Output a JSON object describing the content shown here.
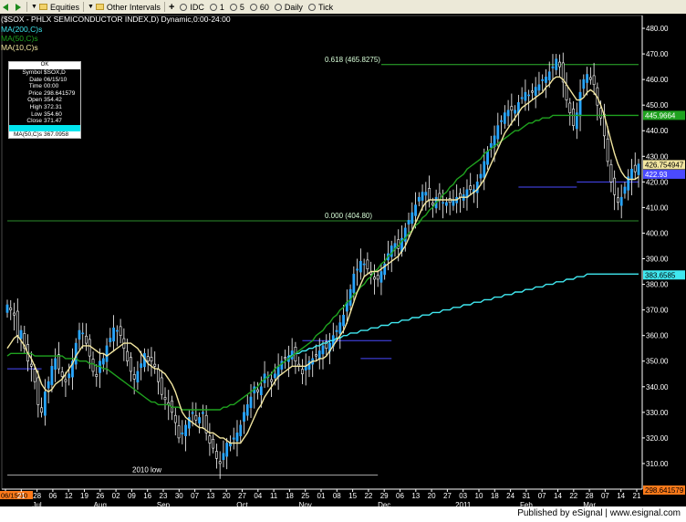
{
  "toolbar": {
    "equities_label": "Equities",
    "other_intervals_label": "Other Intervals",
    "intervals": [
      "IDC",
      "1",
      "5",
      "60",
      "Daily",
      "Tick"
    ]
  },
  "chart_header": {
    "title": "($SOX - PHLX SEMICONDUCTOR INDEX,D) Dynamic,0:00-24:00",
    "ma200_label": "MA(200,C)s",
    "ma50_label": "MA(50,C)s",
    "ma10_label": "MA(10,C)s"
  },
  "data_window": {
    "header": "OK",
    "rows": [
      {
        "k": "Symbol",
        "v": "$SOX,D"
      },
      {
        "k": "Date",
        "v": "06/15/10"
      },
      {
        "k": "Time",
        "v": "00:00"
      },
      {
        "k": "Price",
        "v": "298.641579"
      },
      {
        "k": "Open",
        "v": "354.42"
      },
      {
        "k": "High",
        "v": "372.31"
      },
      {
        "k": "Low",
        "v": "354.60"
      },
      {
        "k": "Close",
        "v": "371.47"
      }
    ],
    "ma200_row": {
      "k": "MA(200,C)s",
      "v": ""
    },
    "ma50_row": {
      "k": "MA(50,C)s",
      "v": "367.0958"
    }
  },
  "footer": {
    "text": "Published by eSignal | www.esignal.com"
  },
  "colors": {
    "candle": "#28a6ff",
    "ma10": "#f2e6a0",
    "ma50": "#1fa21f",
    "ma200": "#40e8f0",
    "fib": "#2fb52f",
    "resistance": "#4a4aff",
    "axis": "#ffffff"
  },
  "chart_data": {
    "type": "candlestick",
    "ylim": [
      300,
      485
    ],
    "yticks": [
      310,
      320,
      330,
      340,
      350,
      360,
      370,
      380,
      390,
      400,
      410,
      420,
      430,
      440,
      450,
      460,
      470,
      480
    ],
    "x_tick_labels": [
      "06/15/10",
      "21",
      "28",
      "06",
      "12",
      "19",
      "26",
      "02",
      "09",
      "16",
      "23",
      "30",
      "07",
      "13",
      "20",
      "27",
      "04",
      "11",
      "18",
      "25",
      "01",
      "08",
      "15",
      "22",
      "29",
      "06",
      "13",
      "20",
      "27",
      "03",
      "10",
      "18",
      "24",
      "31",
      "07",
      "14",
      "22",
      "28",
      "07",
      "14",
      "21"
    ],
    "month_labels": [
      "Jul",
      "Aug",
      "Sep",
      "Oct",
      "Nov",
      "Dec",
      "2011",
      "Feb",
      "Mar"
    ],
    "closes": [
      372,
      370,
      368,
      360,
      362,
      355,
      350,
      348,
      342,
      333,
      330,
      338,
      342,
      348,
      351,
      347,
      344,
      342,
      345,
      350,
      357,
      362,
      361,
      357,
      352,
      346,
      344,
      350,
      351,
      356,
      359,
      363,
      362,
      360,
      355,
      350,
      346,
      343,
      346,
      349,
      353,
      350,
      350,
      348,
      342,
      337,
      335,
      333,
      330,
      326,
      320,
      322,
      325,
      328,
      330,
      327,
      328,
      330,
      322,
      318,
      316,
      312,
      310,
      314,
      318,
      318,
      320,
      322,
      325,
      330,
      333,
      336,
      340,
      338,
      340,
      345,
      344,
      342,
      345,
      348,
      350,
      351,
      352,
      354,
      350,
      348,
      345,
      348,
      350,
      351,
      352,
      354,
      356,
      355,
      357,
      360,
      362,
      365,
      368,
      373,
      378,
      384,
      386,
      389,
      388,
      386,
      384,
      382,
      382,
      385,
      388,
      392,
      395,
      396,
      394,
      398,
      402,
      405,
      408,
      411,
      414,
      416,
      416,
      413,
      411,
      414,
      413,
      412,
      412,
      412,
      413,
      414,
      414,
      415,
      417,
      417,
      417,
      420,
      423,
      428,
      432,
      435,
      438,
      442,
      444,
      447,
      448,
      448,
      448,
      451,
      453,
      455,
      454,
      455,
      457,
      458,
      460,
      461,
      463,
      465,
      468,
      465,
      459,
      452,
      447,
      442,
      447,
      455,
      460,
      462,
      460,
      458,
      450,
      445,
      438,
      428,
      420,
      415,
      412,
      414,
      418,
      422,
      425,
      424,
      427
    ],
    "ma10": [
      355,
      357,
      359,
      360,
      358,
      356,
      353,
      351,
      348,
      345,
      341,
      339,
      338,
      339,
      341,
      342,
      343,
      345,
      347,
      349,
      352,
      354,
      356,
      356,
      356,
      355,
      354,
      353,
      353,
      352,
      353,
      354,
      355,
      356,
      357,
      357,
      357,
      356,
      355,
      353,
      351,
      349,
      348,
      347,
      347,
      346,
      345,
      343,
      341,
      338,
      334,
      330,
      328,
      327,
      326,
      325,
      324,
      324,
      323,
      322,
      322,
      321,
      320,
      320,
      319,
      318,
      318,
      318,
      318,
      320,
      322,
      325,
      328,
      331,
      333,
      336,
      338,
      340,
      342,
      344,
      345,
      346,
      347,
      348,
      348,
      348,
      348,
      348,
      349,
      350,
      350,
      351,
      351,
      352,
      354,
      356,
      358,
      360,
      362,
      365,
      369,
      373,
      377,
      380,
      383,
      384,
      385,
      385,
      385,
      386,
      387,
      388,
      389,
      390,
      391,
      393,
      395,
      398,
      401,
      404,
      407,
      410,
      412,
      413,
      413,
      413,
      413,
      413,
      413,
      413,
      413,
      413,
      414,
      414,
      414,
      415,
      416,
      417,
      419,
      421,
      424,
      427,
      430,
      433,
      436,
      439,
      441,
      443,
      445,
      447,
      449,
      450,
      451,
      452,
      453,
      454,
      455,
      457,
      458,
      460,
      461,
      461,
      460,
      458,
      456,
      454,
      452,
      452,
      453,
      455,
      456,
      455,
      453,
      450,
      446,
      441,
      436,
      431,
      427,
      424,
      422,
      421,
      421,
      421,
      422
    ],
    "ma50": [
      352,
      353,
      353,
      353,
      353,
      353,
      353,
      353,
      352,
      352,
      352,
      352,
      352,
      352,
      352,
      352,
      352,
      351,
      351,
      351,
      351,
      350,
      350,
      350,
      349,
      349,
      348,
      348,
      347,
      347,
      346,
      345,
      344,
      343,
      342,
      341,
      340,
      339,
      338,
      337,
      336,
      335,
      334,
      334,
      333,
      333,
      333,
      333,
      332,
      332,
      332,
      331,
      331,
      331,
      331,
      331,
      331,
      331,
      331,
      331,
      331,
      331,
      331,
      332,
      332,
      333,
      333,
      334,
      335,
      336,
      337,
      338,
      339,
      340,
      342,
      343,
      344,
      345,
      347,
      348,
      349,
      350,
      351,
      352,
      353,
      354,
      355,
      356,
      357,
      358,
      360,
      361,
      362,
      364,
      365,
      367,
      368,
      370,
      371,
      373,
      374,
      376,
      377,
      379,
      380,
      382,
      383,
      385,
      386,
      388,
      389,
      391,
      392,
      394,
      395,
      397,
      398,
      400,
      401,
      403,
      404,
      406,
      407,
      409,
      410,
      412,
      413,
      415,
      416,
      418,
      419,
      421,
      422,
      423,
      425,
      426,
      427,
      428,
      429,
      431,
      432,
      433,
      434,
      435,
      436,
      437,
      438,
      439,
      440,
      440,
      441,
      442,
      443,
      443,
      444,
      444,
      445,
      445,
      445,
      446,
      446,
      446,
      446,
      446,
      446,
      446,
      446,
      446,
      446,
      446,
      446,
      446,
      446,
      446,
      446,
      446,
      446,
      446,
      446,
      446,
      446,
      446,
      446,
      446,
      446
    ],
    "ma200_start_index": 82,
    "ma200": [
      352,
      352,
      353,
      353,
      354,
      354,
      355,
      355,
      356,
      356,
      357,
      357,
      358,
      358,
      359,
      359,
      360,
      360,
      361,
      361,
      361,
      362,
      362,
      362,
      363,
      363,
      363,
      364,
      364,
      364,
      365,
      365,
      365,
      366,
      366,
      366,
      367,
      367,
      367,
      368,
      368,
      368,
      369,
      369,
      369,
      370,
      370,
      370,
      371,
      371,
      371,
      372,
      372,
      372,
      373,
      373,
      373,
      374,
      374,
      374,
      375,
      375,
      375,
      376,
      376,
      376,
      377,
      377,
      377,
      378,
      378,
      378,
      379,
      379,
      379,
      380,
      380,
      380,
      381,
      381,
      381,
      382,
      382,
      382,
      383,
      383,
      383,
      384,
      384,
      384,
      384,
      384,
      384,
      384,
      384,
      384,
      384,
      384,
      384,
      384,
      384,
      384,
      384
    ],
    "levels": [
      {
        "label": "0.618 (465.8275)",
        "value": 465.8275,
        "from_index": 109,
        "to_index": 184
      },
      {
        "label": "0.000 (404.80)",
        "value": 404.8,
        "from_index": 0,
        "to_index": 184
      },
      {
        "label": "2010 low",
        "value": 305.5,
        "from_index": 0,
        "to_index": 108
      }
    ],
    "resistance_lines": [
      {
        "value": 347,
        "from_index": 0,
        "to_index": 10
      },
      {
        "value": 358,
        "from_index": 86,
        "to_index": 112
      },
      {
        "value": 351,
        "from_index": 103,
        "to_index": 112
      },
      {
        "value": 418,
        "from_index": 149,
        "to_index": 166
      },
      {
        "value": 420,
        "from_index": 166,
        "to_index": 184
      }
    ],
    "price_tags": [
      {
        "label": "445.9664",
        "value": 446,
        "kind": "ma50"
      },
      {
        "label": "426.754947",
        "value": 426.75,
        "kind": "ma10"
      },
      {
        "label": "422.93",
        "value": 423,
        "kind": "resistance"
      },
      {
        "label": "383.6585",
        "value": 383.66,
        "kind": "ma200"
      },
      {
        "label": "298.641579",
        "value": 298.64,
        "kind": "cursor"
      }
    ]
  }
}
